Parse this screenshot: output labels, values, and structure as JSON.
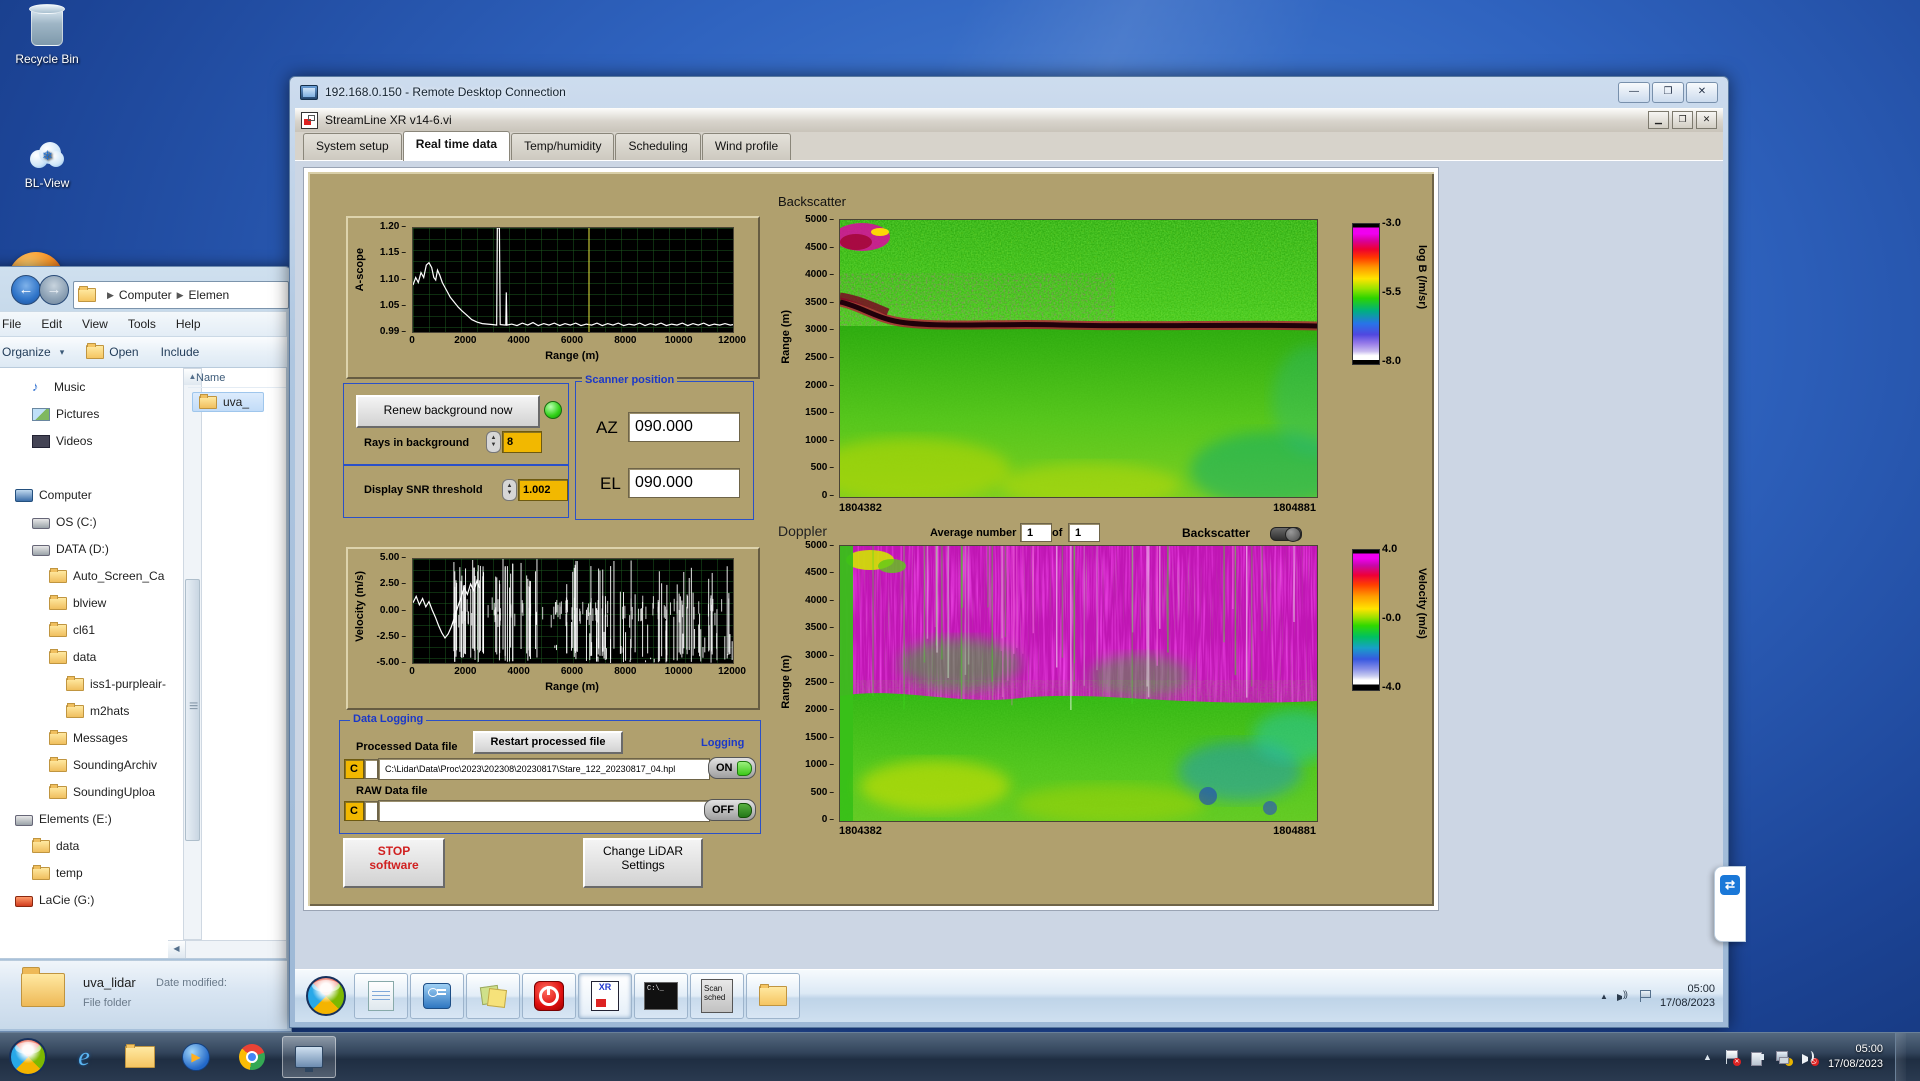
{
  "desktop": {
    "icons": [
      {
        "name": "recycle-bin",
        "label": "Recycle Bin"
      },
      {
        "name": "bl-view",
        "label": "BL-View"
      }
    ]
  },
  "explorer": {
    "menu": [
      "File",
      "Edit",
      "View",
      "Tools",
      "Help"
    ],
    "toolbar": {
      "organize": "Organize",
      "open": "Open",
      "include": "Include"
    },
    "address": {
      "root": "Computer",
      "segment": "Elemen"
    },
    "tree": [
      {
        "label": "Music",
        "icon": "music",
        "indent": 2
      },
      {
        "label": "Pictures",
        "icon": "pic",
        "indent": 2
      },
      {
        "label": "Videos",
        "icon": "vid",
        "indent": 2
      },
      {
        "label": "",
        "icon": "spacer",
        "indent": 0
      },
      {
        "label": "Computer",
        "icon": "comp",
        "indent": 1
      },
      {
        "label": "OS (C:)",
        "icon": "drive",
        "indent": 2
      },
      {
        "label": "DATA (D:)",
        "icon": "drive",
        "indent": 2
      },
      {
        "label": "Auto_Screen_Ca",
        "icon": "folder",
        "indent": 3
      },
      {
        "label": "blview",
        "icon": "folder",
        "indent": 3
      },
      {
        "label": "cl61",
        "icon": "folder",
        "indent": 3
      },
      {
        "label": "data",
        "icon": "folder",
        "indent": 3
      },
      {
        "label": "iss1-purpleair-",
        "icon": "folder",
        "indent": 4
      },
      {
        "label": "m2hats",
        "icon": "folder",
        "indent": 4
      },
      {
        "label": "Messages",
        "icon": "folder",
        "indent": 3
      },
      {
        "label": "SoundingArchiv",
        "icon": "folder",
        "indent": 3
      },
      {
        "label": "SoundingUploa",
        "icon": "folder",
        "indent": 3
      },
      {
        "label": "Elements (E:)",
        "icon": "drive",
        "indent": 1
      },
      {
        "label": "data",
        "icon": "folder",
        "indent": 2
      },
      {
        "label": "temp",
        "icon": "folder",
        "indent": 2
      },
      {
        "label": "LaCie (G:)",
        "icon": "drive-red",
        "indent": 1
      }
    ],
    "columns": {
      "name": "Name"
    },
    "files": [
      {
        "label": "uva_"
      }
    ],
    "details": {
      "name": "uva_lidar",
      "modified_label": "Date modified:",
      "type": "File folder"
    }
  },
  "rdp": {
    "title": "192.168.0.150 - Remote Desktop Connection",
    "session_taskbar": {
      "xr_label": "XR",
      "cmd_label": "C:\\_",
      "scan_sched_lines": [
        "Scan",
        "sched"
      ],
      "clock": {
        "time": "05:00",
        "date": "17/08/2023"
      }
    }
  },
  "vi": {
    "title": "StreamLine XR v14-6.vi",
    "tabs": [
      "System setup",
      "Real time data",
      "Temp/humidity",
      "Scheduling",
      "Wind profile"
    ],
    "active_tab": 1,
    "renew_button": "Renew background now",
    "rays_label": "Rays in background",
    "rays_value": "8",
    "snr_label": "Display SNR threshold",
    "snr_value": "1.002",
    "scanner": {
      "title": "Scanner position",
      "az_label": "AZ",
      "az_value": "090.000",
      "el_label": "EL",
      "el_value": "090.000"
    },
    "backscatter": {
      "title": "Backscatter",
      "x_start": "1804382",
      "x_end": "1804881",
      "range_label": "Range (m)",
      "range_ticks": [
        "5000",
        "4500",
        "4000",
        "3500",
        "3000",
        "2500",
        "2000",
        "1500",
        "1000",
        "500",
        "0"
      ],
      "colorbar": {
        "ticks": [
          "-3.0",
          "-5.5",
          "-8.0"
        ],
        "label": "log B (/m/sr)"
      }
    },
    "doppler": {
      "title": "Doppler",
      "avg_label": "Average number",
      "avg_value": "1",
      "of_label": "of",
      "avg_total": "1",
      "toggle_label": "Backscatter",
      "x_start": "1804382",
      "x_end": "1804881",
      "range_label": "Range (m)",
      "range_ticks": [
        "5000",
        "4500",
        "4000",
        "3500",
        "3000",
        "2500",
        "2000",
        "1500",
        "1000",
        "500",
        "0"
      ],
      "colorbar": {
        "ticks": [
          "4.0",
          "-0.0",
          "-4.0"
        ],
        "label": "Velocity (m/s)"
      }
    },
    "ascope": {
      "ylabel": "A-scope",
      "yticks": [
        "1.20",
        "1.15",
        "1.10",
        "1.05",
        "0.99"
      ],
      "xticks": [
        "0",
        "2000",
        "4000",
        "6000",
        "8000",
        "10000",
        "12000"
      ],
      "xlabel": "Range (m)"
    },
    "velocity": {
      "ylabel": "Velocity (m/s)",
      "yticks": [
        "5.00",
        "2.50",
        "0.00",
        "-2.50",
        "-5.00"
      ],
      "xticks": [
        "0",
        "2000",
        "4000",
        "6000",
        "8000",
        "10000",
        "12000"
      ],
      "xlabel": "Range (m)"
    },
    "logging": {
      "title": "Data Logging",
      "processed_label": "Processed Data file",
      "restart_button": "Restart processed file",
      "logging_label": "Logging",
      "drive_label": "C",
      "processed_path": "C:\\Lidar\\Data\\Proc\\2023\\202308\\20230817\\Stare_122_20230817_04.hpl",
      "on_label": "ON",
      "raw_label": "RAW Data file",
      "raw_path": "",
      "off_label": "OFF"
    },
    "stop_button_lines": [
      "STOP",
      "software"
    ],
    "change_button_lines": [
      "Change LiDAR",
      "Settings"
    ]
  },
  "host_taskbar": {
    "clock": {
      "time": "05:00",
      "date": "17/08/2023"
    }
  },
  "chart_data": [
    {
      "type": "line",
      "title": "A-scope",
      "ylabel": "A-scope",
      "xlabel": "Range (m)",
      "xlim": [
        0,
        12000
      ],
      "ylim": [
        0.99,
        1.2
      ],
      "xticks": [
        0,
        2000,
        4000,
        6000,
        8000,
        10000,
        12000
      ],
      "yticks": [
        1.2,
        1.15,
        1.1,
        1.05,
        0.99
      ],
      "cursor_x": 6600,
      "grid": true,
      "points": [
        [
          0,
          1.085
        ],
        [
          100,
          1.1
        ],
        [
          200,
          1.09
        ],
        [
          300,
          1.11
        ],
        [
          400,
          1.1
        ],
        [
          500,
          1.125
        ],
        [
          600,
          1.13
        ],
        [
          700,
          1.12
        ],
        [
          780,
          1.1
        ],
        [
          850,
          1.095
        ],
        [
          920,
          1.115
        ],
        [
          1000,
          1.105
        ],
        [
          1100,
          1.09
        ],
        [
          1250,
          1.075
        ],
        [
          1400,
          1.06
        ],
        [
          1550,
          1.05
        ],
        [
          1700,
          1.04
        ],
        [
          1850,
          1.032
        ],
        [
          2000,
          1.025
        ],
        [
          2200,
          1.015
        ],
        [
          2400,
          1.01
        ],
        [
          2600,
          1.007
        ],
        [
          2800,
          1.006
        ],
        [
          3000,
          1.005
        ],
        [
          3140,
          1.004
        ],
        [
          3160,
          1.21
        ],
        [
          3240,
          1.21
        ],
        [
          3270,
          1.005
        ],
        [
          3480,
          1.004
        ],
        [
          3500,
          1.07
        ],
        [
          3520,
          1.004
        ],
        [
          3700,
          1.006
        ],
        [
          3900,
          1.003
        ],
        [
          4100,
          1.008
        ],
        [
          4300,
          1.004
        ],
        [
          4500,
          1.009
        ],
        [
          4700,
          1.003
        ],
        [
          4900,
          1.007
        ],
        [
          5100,
          1.004
        ],
        [
          5300,
          1.008
        ],
        [
          5500,
          1.003
        ],
        [
          5700,
          1.007
        ],
        [
          5900,
          1.004
        ],
        [
          6100,
          1.008
        ],
        [
          6300,
          1.003
        ],
        [
          6500,
          1.006
        ],
        [
          6700,
          1.004
        ],
        [
          6900,
          1.008
        ],
        [
          7100,
          1.003
        ],
        [
          7300,
          1.007
        ],
        [
          7500,
          1.004
        ],
        [
          7700,
          1.008
        ],
        [
          7900,
          1.003
        ],
        [
          8100,
          1.006
        ],
        [
          8300,
          1.004
        ],
        [
          8500,
          1.008
        ],
        [
          8700,
          1.003
        ],
        [
          8900,
          1.007
        ],
        [
          9100,
          1.004
        ],
        [
          9300,
          1.008
        ],
        [
          9500,
          1.003
        ],
        [
          9700,
          1.006
        ],
        [
          9900,
          1.004
        ],
        [
          10100,
          1.008
        ],
        [
          10300,
          1.003
        ],
        [
          10500,
          1.007
        ],
        [
          10700,
          1.004
        ],
        [
          10900,
          1.008
        ],
        [
          11100,
          1.003
        ],
        [
          11300,
          1.006
        ],
        [
          11500,
          1.004
        ],
        [
          11700,
          1.007
        ],
        [
          11900,
          1.004
        ],
        [
          12000,
          1.005
        ]
      ]
    },
    {
      "type": "heatmap",
      "title": "Backscatter",
      "ylabel": "Range (m)",
      "ylim": [
        0,
        5000
      ],
      "x_range_labels": [
        "1804382",
        "1804881"
      ],
      "colorbar_label": "log B (/m/sr)",
      "colorbar_ticks": [
        -3.0,
        -5.5,
        -8.0
      ],
      "features": [
        {
          "name": "boundary-layer",
          "range_m": [
            0,
            1200
          ],
          "signal": "enhanced yellow-green backscatter near surface"
        },
        {
          "name": "attenuating-cloud-band",
          "range_m": [
            3000,
            3300
          ],
          "signal": "dark saturated band across full record"
        },
        {
          "name": "cloud-rise-at-start",
          "range_m": [
            3300,
            3600
          ],
          "signal": "band rises near record start, magenta speckle above"
        },
        {
          "name": "upper-noise",
          "range_m": [
            3300,
            5000
          ],
          "signal": "green speckle noise"
        },
        {
          "name": "hotspot-top-left",
          "range_m": [
            4600,
            5000
          ],
          "signal": "magenta/yellow strong return"
        }
      ]
    },
    {
      "type": "line",
      "title": "Velocity",
      "ylabel": "Velocity (m/s)",
      "xlabel": "Range (m)",
      "xlim": [
        0,
        12000
      ],
      "ylim": [
        -5,
        5
      ],
      "xticks": [
        0,
        2000,
        4000,
        6000,
        8000,
        10000,
        12000
      ],
      "yticks": [
        5.0,
        2.5,
        0.0,
        -2.5,
        -5.0
      ],
      "grid": true,
      "points": [
        [
          0,
          0.8
        ],
        [
          120,
          1.4
        ],
        [
          240,
          0.6
        ],
        [
          360,
          1.2
        ],
        [
          480,
          0.4
        ],
        [
          600,
          0.9
        ],
        [
          720,
          0.1
        ],
        [
          840,
          -0.6
        ],
        [
          960,
          -1.4
        ],
        [
          1080,
          -2.1
        ],
        [
          1200,
          -2.6
        ],
        [
          1320,
          -2.2
        ],
        [
          1440,
          -1.5
        ],
        [
          1560,
          -0.6
        ],
        [
          1680,
          0.4
        ],
        [
          1800,
          1.3
        ],
        [
          1920,
          2.2
        ],
        [
          2040,
          1.6
        ],
        [
          2160,
          2.6
        ],
        [
          2280,
          1.9
        ],
        [
          2400,
          2.9
        ],
        [
          2500,
          2.2
        ]
      ],
      "noise": {
        "seed": 7,
        "count": 160,
        "tick_count": 90,
        "full_band_x": [
          1500,
          5200
        ]
      }
    },
    {
      "type": "heatmap",
      "title": "Doppler",
      "ylabel": "Range (m)",
      "ylim": [
        0,
        5000
      ],
      "x_range_labels": [
        "1804382",
        "1804881"
      ],
      "colorbar_label": "Velocity (m/s)",
      "colorbar_ticks": [
        4.0,
        0.0,
        -4.0
      ],
      "features": [
        {
          "name": "boundary-layer",
          "range_m": [
            0,
            1500
          ],
          "signal": "coherent green/yellow velocities near 0 m/s"
        },
        {
          "name": "noise-region",
          "range_m": [
            1800,
            5000
          ],
          "signal": "magenta noise with vertical green/white streaks"
        },
        {
          "name": "cyan-downdraft-patches",
          "range_m": [
            400,
            1500
          ],
          "signal": "blue-cyan patches lower right"
        }
      ]
    }
  ]
}
